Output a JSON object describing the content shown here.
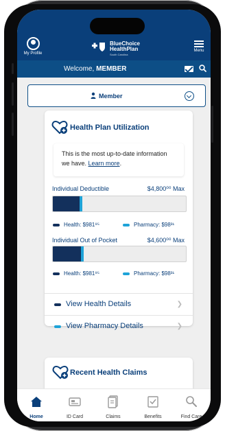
{
  "header": {
    "profile_label": "My Profile",
    "logo_line1": "BlueChoice",
    "logo_line2": "HealthPlan",
    "logo_sub": "South Carolina",
    "menu_label": "Menu"
  },
  "welcome": {
    "prefix": "Welcome, ",
    "name": "MEMBER"
  },
  "member_selector": {
    "label": "Member"
  },
  "utilization": {
    "title": "Health Plan Utilization",
    "notice_text": "This is the most up-to-date information we have. ",
    "notice_link": "Learn more",
    "notice_period": ".",
    "deductible": {
      "title": "Individual Deductible",
      "max": "$4,800⁰⁰ Max",
      "health_label": "Health: $981⁹⁵",
      "pharmacy_label": "Pharmacy: $98³¹",
      "health_fill": 0.2,
      "pharmacy_fill": 0.02
    },
    "out_of_pocket": {
      "title": "Individual Out of Pocket",
      "max": "$4,600⁰⁰ Max",
      "health_label": "Health: $981⁹⁵",
      "pharmacy_label": "Pharmacy: $98³¹",
      "health_fill": 0.21,
      "pharmacy_fill": 0.02
    },
    "details": [
      {
        "label": "View Health Details",
        "color": "#13305c"
      },
      {
        "label": "View Pharmacy Details",
        "color": "#1ea3d8"
      }
    ]
  },
  "recent_claims": {
    "title": "Recent Health Claims"
  },
  "bottom_nav": [
    {
      "label": "Home",
      "icon": "home-icon",
      "active": true
    },
    {
      "label": "ID Card",
      "icon": "id-card-icon",
      "active": false
    },
    {
      "label": "Claims",
      "icon": "claims-icon",
      "active": false
    },
    {
      "label": "Benefits",
      "icon": "benefits-icon",
      "active": false
    },
    {
      "label": "Find Care",
      "icon": "find-care-icon",
      "active": false
    }
  ],
  "colors": {
    "brand": "#0a3f7a",
    "health": "#13305c",
    "pharmacy": "#1ea3d8"
  }
}
